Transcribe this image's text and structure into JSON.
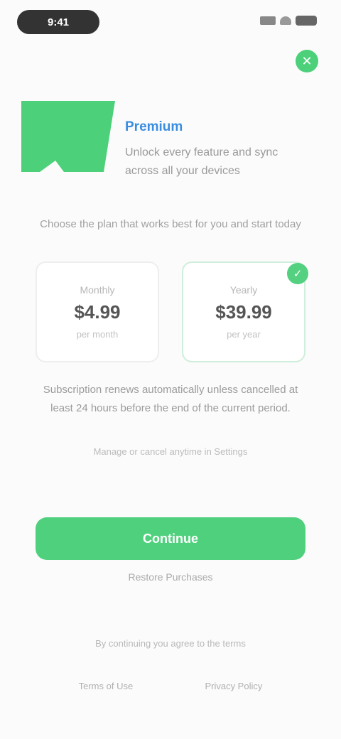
{
  "status_bar": {
    "time": "9:41"
  },
  "header": {
    "close_icon": "close-icon"
  },
  "hero": {
    "title": "Premium",
    "description": "Unlock every feature and sync across all your devices"
  },
  "subtitle": "Choose the plan that works best for you and start today",
  "plans": [
    {
      "name": "Monthly",
      "price": "$4.99",
      "note": "per month"
    },
    {
      "name": "Yearly",
      "price": "$39.99",
      "note": "per year"
    }
  ],
  "selected_plan_icon": "check-icon",
  "body": {
    "text": "Subscription renews automatically unless cancelled at least 24 hours before the end of the current period.",
    "small_print": "Manage or cancel anytime in Settings"
  },
  "cta": {
    "label": "Continue"
  },
  "restore_label": "Restore Purchases",
  "footer": {
    "line": "By continuing you agree to the terms",
    "links": [
      "Terms of Use",
      "Privacy Policy"
    ]
  },
  "colors": {
    "accent": "#4fd07d",
    "title": "#3a8de0"
  }
}
